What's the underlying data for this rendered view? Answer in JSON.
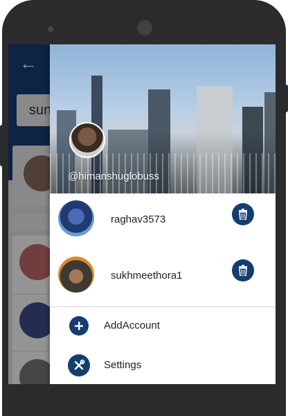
{
  "profile": {
    "handle": "@himanshuglobuss"
  },
  "accounts": [
    {
      "username": "raghav3573",
      "delete_icon": "trash-icon"
    },
    {
      "username": "sukhmeethora1",
      "delete_icon": "trash-icon"
    }
  ],
  "menu": [
    {
      "label": "AddAccount",
      "icon": "plus-icon"
    },
    {
      "label": "Settings",
      "icon": "tools-icon"
    }
  ],
  "background_app": {
    "search_text": "sun",
    "back_icon": "back-arrow-icon"
  },
  "colors": {
    "accent": "#143e6f",
    "appbar": "#173f73"
  }
}
